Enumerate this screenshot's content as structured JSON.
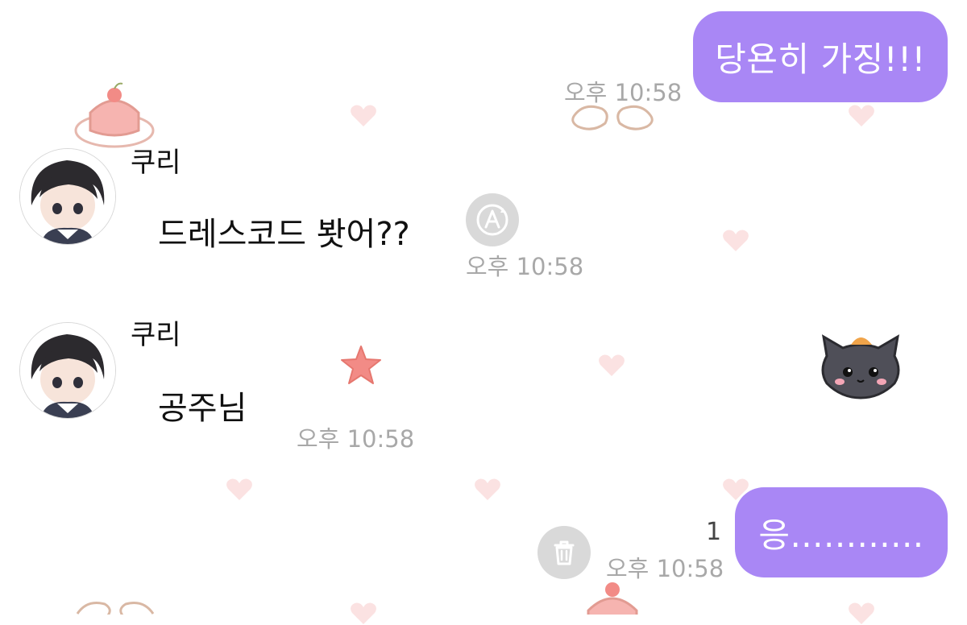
{
  "chat": {
    "messages": [
      {
        "direction": "outgoing",
        "text": "당욘히 가징!!!",
        "time": "오후 10:58"
      },
      {
        "direction": "incoming",
        "sender": "쿠리",
        "text": "드레스코드 봣어??",
        "time": "오후 10:58"
      },
      {
        "direction": "incoming",
        "sender": "쿠리",
        "text": "공주님",
        "time": "오후 10:58"
      },
      {
        "direction": "outgoing",
        "text": "응............",
        "time": "오후 10:58",
        "unread_count": "1"
      }
    ]
  },
  "icons": {
    "translate": "translate-icon",
    "delete": "trash-icon"
  },
  "colors": {
    "outgoing_bubble": "#a987f5",
    "timestamp": "#a8a8a8",
    "action_button": "#d9d9d9",
    "wallpaper_heart": "#f9dada"
  }
}
